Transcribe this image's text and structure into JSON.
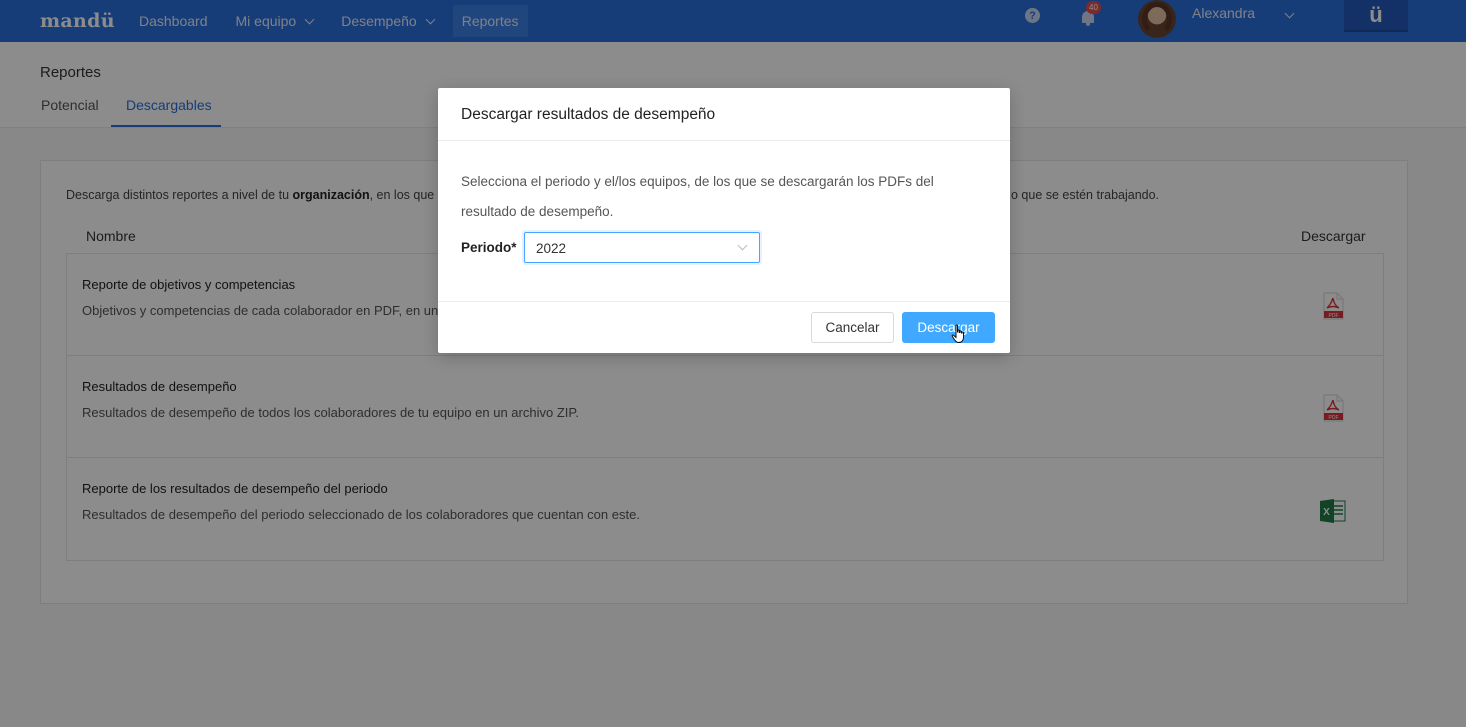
{
  "navbar": {
    "logo": "mandü",
    "items": [
      {
        "label": "Dashboard",
        "has_dropdown": false
      },
      {
        "label": "Mi equipo",
        "has_dropdown": true
      },
      {
        "label": "Desempeño",
        "has_dropdown": true
      },
      {
        "label": "Reportes",
        "has_dropdown": false,
        "active": true
      }
    ],
    "help_icon": "?",
    "notification_count": "40",
    "user_name": "Alexandra",
    "brand_mark": "ü"
  },
  "page": {
    "title": "Reportes",
    "tabs": [
      {
        "label": "Potencial",
        "active": false
      },
      {
        "label": "Descargables",
        "active": true
      }
    ]
  },
  "card": {
    "description_start": "Descarga distintos reportes a nivel de tu ",
    "description_bold": "organización",
    "description_mid": ", en los que",
    "description_tail": "o que se estén trabajando.",
    "col_name": "Nombre",
    "col_download": "Descargar",
    "rows": [
      {
        "title": "Reporte de objetivos y competencias",
        "description": "Objetivos y competencias de cada colaborador en PDF, en un ar",
        "icon": "pdf-icon"
      },
      {
        "title": "Resultados de desempeño",
        "description": "Resultados de desempeño de todos los colaboradores de tu equipo en un archivo ZIP.",
        "icon": "pdf-icon"
      },
      {
        "title": "Reporte de los resultados de desempeño del periodo",
        "description": "Resultados de desempeño del periodo seleccionado de los colaboradores que cuentan con este.",
        "icon": "excel-icon"
      }
    ]
  },
  "modal": {
    "title": "Descargar resultados de desempeño",
    "text": "Selecciona el periodo y el/los equipos, de los que se descargarán los PDFs del resultado de desempeño.",
    "period_label": "Periodo*",
    "period_value": "2022",
    "cancel_label": "Cancelar",
    "download_label": "Descargar"
  },
  "colors": {
    "navbar": "#2b6fdc",
    "primary_button": "#40a9ff",
    "pdf_red": "#d9363e",
    "excel_green": "#1f7a45"
  }
}
